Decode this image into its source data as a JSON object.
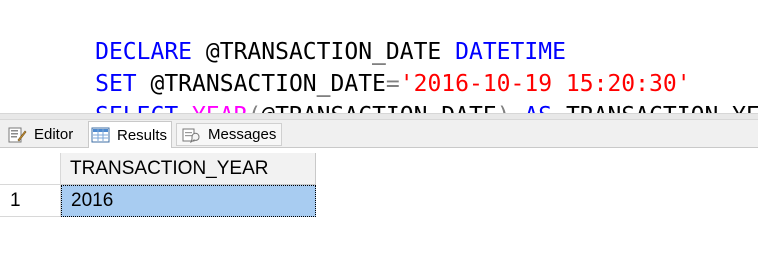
{
  "editor": {
    "lines": [
      {
        "tokens": [
          {
            "text": "DECLARE",
            "kind": "keyword"
          },
          {
            "text": " @TRANSACTION_DATE ",
            "kind": "text"
          },
          {
            "text": "DATETIME",
            "kind": "keyword"
          }
        ]
      },
      {
        "tokens": [
          {
            "text": "SET",
            "kind": "keyword"
          },
          {
            "text": " @TRANSACTION_DATE",
            "kind": "text"
          },
          {
            "text": "=",
            "kind": "gray"
          },
          {
            "text": "'2016-10-19 15:20:30'",
            "kind": "string"
          }
        ]
      },
      {
        "tokens": [
          {
            "text": "SELECT",
            "kind": "keyword"
          },
          {
            "text": " ",
            "kind": "text"
          },
          {
            "text": "YEAR",
            "kind": "function"
          },
          {
            "text": "(",
            "kind": "gray"
          },
          {
            "text": "@TRANSACTION_DATE",
            "kind": "text"
          },
          {
            "text": ")",
            "kind": "gray"
          },
          {
            "text": " ",
            "kind": "text"
          },
          {
            "text": "AS",
            "kind": "keyword"
          },
          {
            "text": " TRANSACTION_YEAR",
            "kind": "text"
          }
        ]
      }
    ]
  },
  "tabs": [
    {
      "label": "Editor",
      "icon": "editor-icon",
      "active": false
    },
    {
      "label": "Results",
      "icon": "results-grid-icon",
      "active": true
    },
    {
      "label": "Messages",
      "icon": "messages-icon",
      "active": false
    }
  ],
  "results": {
    "columns": [
      "TRANSACTION_YEAR"
    ],
    "rows": [
      {
        "row_number": "1",
        "values": [
          "2016"
        ]
      }
    ]
  },
  "colors": {
    "keyword": "#0000ff",
    "function": "#ff00ff",
    "string": "#ff0000",
    "selected_cell": "#a8ccf1"
  }
}
